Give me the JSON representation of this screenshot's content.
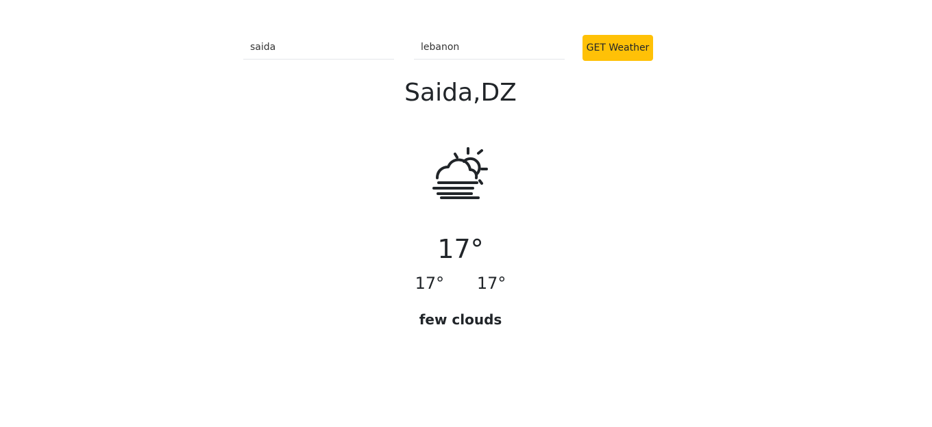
{
  "search": {
    "city_value": "saida",
    "country_value": "lebanon",
    "button_label": "GET Weather"
  },
  "weather": {
    "location": "Saida,DZ",
    "icon": "fog-cloud-sun-icon",
    "temperature": "17°",
    "temp_min": "17°",
    "temp_max": "17°",
    "description": "few clouds"
  },
  "colors": {
    "accent": "#ffc107",
    "text": "#212529"
  }
}
